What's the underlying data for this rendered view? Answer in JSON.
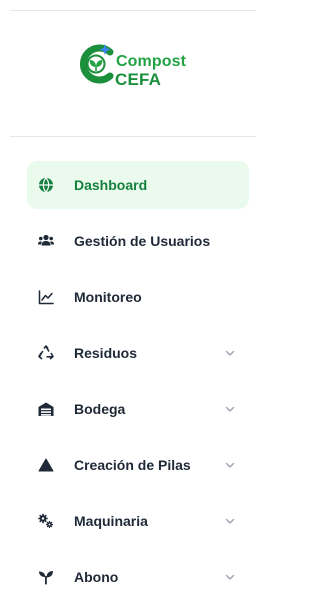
{
  "logo": {
    "line1": "Compost",
    "line2": "CEFA"
  },
  "nav": [
    {
      "label": "Dashboard",
      "icon": "globe-icon",
      "active": true,
      "has_chevron": false
    },
    {
      "label": "Gestión de Usuarios",
      "icon": "users-icon",
      "active": false,
      "has_chevron": false
    },
    {
      "label": "Monitoreo",
      "icon": "line-chart-icon",
      "active": false,
      "has_chevron": false
    },
    {
      "label": "Residuos",
      "icon": "recycle-icon",
      "active": false,
      "has_chevron": true
    },
    {
      "label": "Bodega",
      "icon": "warehouse-icon",
      "active": false,
      "has_chevron": true
    },
    {
      "label": "Creación de Pilas",
      "icon": "triangle-icon",
      "active": false,
      "has_chevron": true
    },
    {
      "label": "Maquinaria",
      "icon": "gears-icon",
      "active": false,
      "has_chevron": true
    },
    {
      "label": "Abono",
      "icon": "seedling-icon",
      "active": false,
      "has_chevron": true
    }
  ],
  "colors": {
    "accent": "#15803d",
    "active_bg": "#eafbee",
    "logo_green": "#22a344"
  }
}
